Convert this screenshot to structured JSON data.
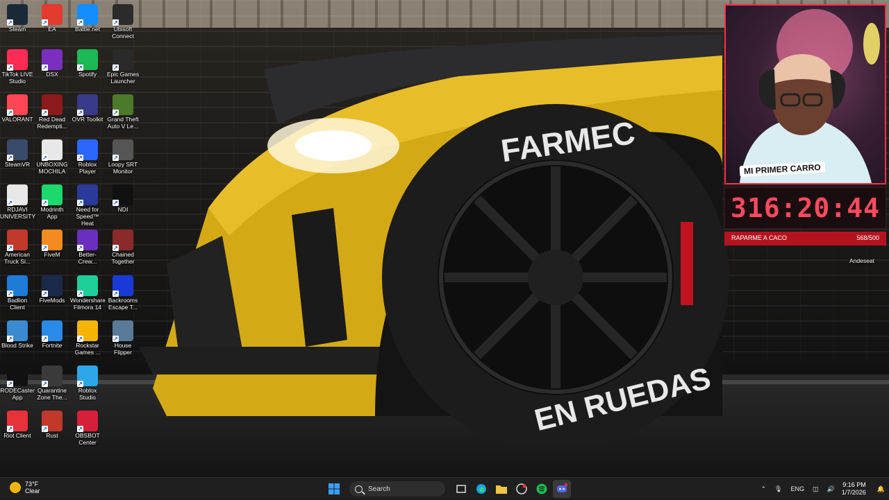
{
  "desktop": {
    "icons": [
      {
        "label": "Steam",
        "color": "#1b2838"
      },
      {
        "label": "EA",
        "color": "#e33b2e"
      },
      {
        "label": "Battle.net",
        "color": "#148eff"
      },
      {
        "label": "Ubisoft Connect",
        "color": "#2b2b2b"
      },
      {
        "label": "TikTok LIVE Studio",
        "color": "#fe2c55"
      },
      {
        "label": "DSX",
        "color": "#7b2fbe"
      },
      {
        "label": "Spotify",
        "color": "#1db954"
      },
      {
        "label": "Epic Games Launcher",
        "color": "#2a2a2a"
      },
      {
        "label": "VALORANT",
        "color": "#ff4655"
      },
      {
        "label": "Red Dead Redempti...",
        "color": "#8b1a1a"
      },
      {
        "label": "OVR Toolkit",
        "color": "#3a3a8a"
      },
      {
        "label": "Grand Theft Auto V Le...",
        "color": "#4a7a2a"
      },
      {
        "label": "SteamVR",
        "color": "#3a4a6a"
      },
      {
        "label": "UNBOXING MOCHILA",
        "color": "#e8e8e8"
      },
      {
        "label": "Roblox Player",
        "color": "#2a66ff"
      },
      {
        "label": "Loopy SRT Monitor",
        "color": "#555555"
      },
      {
        "label": "RDJAVI UNIVERSITY",
        "color": "#e8e8e8"
      },
      {
        "label": "Modrinth App",
        "color": "#1bd96a"
      },
      {
        "label": "Need for Speed™ Heat",
        "color": "#2a3a9a"
      },
      {
        "label": "NDI",
        "color": "#111111"
      },
      {
        "label": "American Truck Si...",
        "color": "#c0392b"
      },
      {
        "label": "FiveM",
        "color": "#f38b1f"
      },
      {
        "label": "Better-Crew...",
        "color": "#6a2fbf"
      },
      {
        "label": "Chained Together",
        "color": "#8a2a2a"
      },
      {
        "label": "Badlion Client",
        "color": "#1e7bd8"
      },
      {
        "label": "FiveMods",
        "color": "#1a2a4a"
      },
      {
        "label": "Wondershare Filmora 14",
        "color": "#1ecf9a"
      },
      {
        "label": "Backrooms Escape T...",
        "color": "#1a3ad8"
      },
      {
        "label": "Blood Strike",
        "color": "#3a8acf"
      },
      {
        "label": "Fortnite",
        "color": "#2a8ae8"
      },
      {
        "label": "Rockstar Games ...",
        "color": "#f4b400"
      },
      {
        "label": "House Flipper",
        "color": "#5a7a9a"
      },
      {
        "label": "RODECaster App",
        "color": "#111111"
      },
      {
        "label": "Quarantine Zone The...",
        "color": "#3a3a3a"
      },
      {
        "label": "Roblox Studio",
        "color": "#2aa8e8"
      },
      {
        "label": "Riot Client",
        "color": "#e8323a"
      },
      {
        "label": "Rust",
        "color": "#c0392b"
      },
      {
        "label": "OBSBOT Center",
        "color": "#d81f3a"
      },
      {
        "label": "Andeseat",
        "color": "#333333"
      }
    ]
  },
  "wallpaper": {
    "tire_top_text": "FARMEC",
    "tire_bottom_text": "EN RUEDAS"
  },
  "overlay": {
    "cam_tag": "MI PRIMER CARRO",
    "timer": "316:20:44",
    "goal_label": "RAPARME A CACO",
    "goal_count": "568/500",
    "goal_progress": 1.0
  },
  "taskbar": {
    "weather_temp": "73°F",
    "weather_condition": "Clear",
    "search_placeholder": "Search",
    "language": "ENG",
    "time": "9:16 PM",
    "date": "1/7/2026"
  }
}
